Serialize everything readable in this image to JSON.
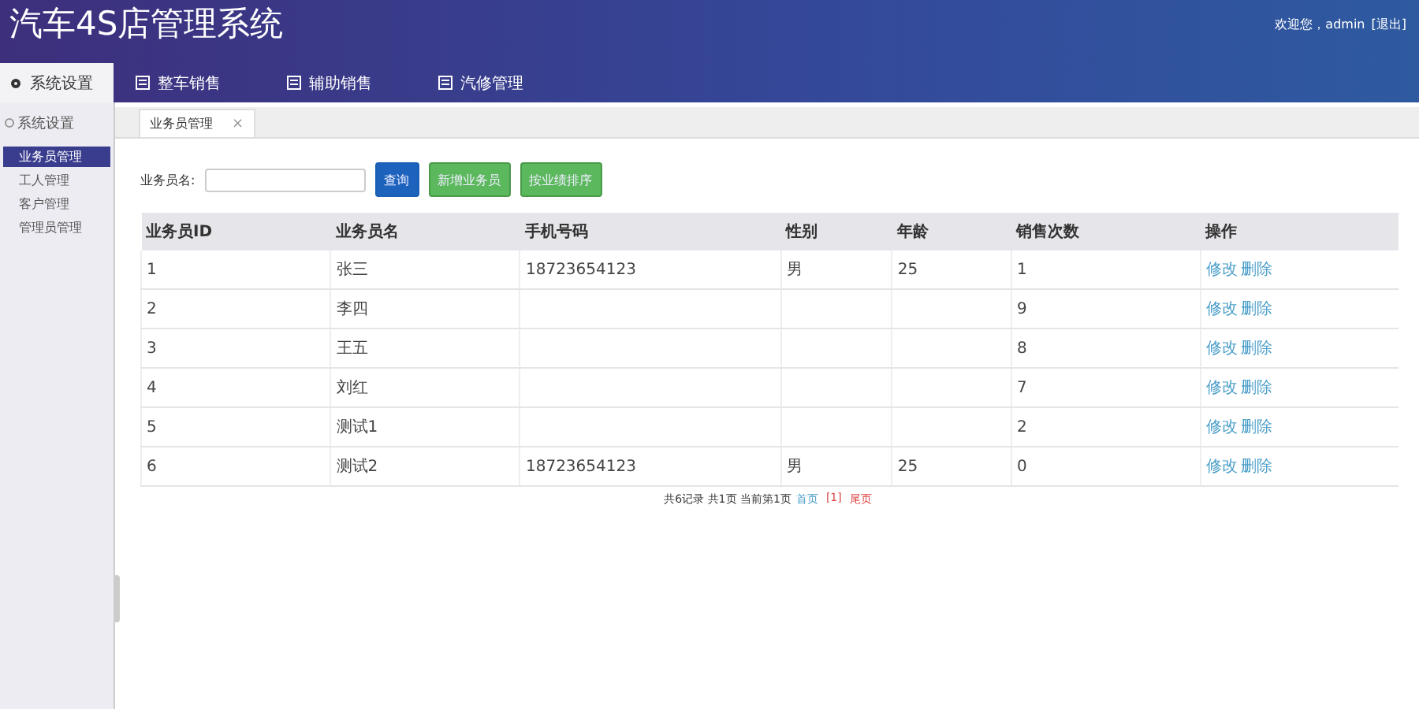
{
  "app_title": "汽车4S店管理系统",
  "user_bar": {
    "greeting": "欢迎您，admin",
    "logout": "[退出]"
  },
  "nav_tabs": [
    {
      "label": "系统设置",
      "selected": true
    },
    {
      "label": "整车销售",
      "selected": false
    },
    {
      "label": "辅助销售",
      "selected": false
    },
    {
      "label": "汽修管理",
      "selected": false
    }
  ],
  "sidebar": {
    "title": "系统设置",
    "items": [
      {
        "label": "业务员管理",
        "selected": true
      },
      {
        "label": "工人管理",
        "selected": false
      },
      {
        "label": "客户管理",
        "selected": false
      },
      {
        "label": "管理员管理",
        "selected": false
      }
    ]
  },
  "page_tab": {
    "label": "业务员管理",
    "close": "×"
  },
  "search": {
    "label": "业务员名:",
    "buttons": [
      {
        "label": "查询",
        "kind": "primary"
      },
      {
        "label": "新增业务员",
        "kind": "success"
      },
      {
        "label": "按业绩排序",
        "kind": "success"
      }
    ]
  },
  "table": {
    "columns": [
      "业务员ID",
      "业务员名",
      "手机号码",
      "性别",
      "年龄",
      "销售次数",
      "操作"
    ],
    "rows": [
      {
        "cells": [
          "1",
          "张三",
          "18723654123",
          "男",
          "25",
          "1"
        ],
        "actions": [
          "修改",
          "删除"
        ]
      },
      {
        "cells": [
          "2",
          "李四",
          null,
          null,
          null,
          "9"
        ],
        "actions": [
          "修改",
          "删除"
        ]
      },
      {
        "cells": [
          "3",
          "王五",
          null,
          null,
          null,
          "8"
        ],
        "actions": [
          "修改",
          "删除"
        ]
      },
      {
        "cells": [
          "4",
          "刘红",
          null,
          null,
          null,
          "7"
        ],
        "actions": [
          "修改",
          "删除"
        ]
      },
      {
        "cells": [
          "5",
          "测试1",
          null,
          null,
          null,
          "2"
        ],
        "actions": [
          "修改",
          "删除"
        ]
      },
      {
        "cells": [
          "6",
          "测试2",
          "18723654123",
          "男",
          "25",
          "0"
        ],
        "actions": [
          "修改",
          "删除"
        ]
      }
    ]
  },
  "pagination": {
    "summary": "共6记录 共1页 当前第1页",
    "first": "首页",
    "current": "[1]",
    "last": "尾页"
  }
}
